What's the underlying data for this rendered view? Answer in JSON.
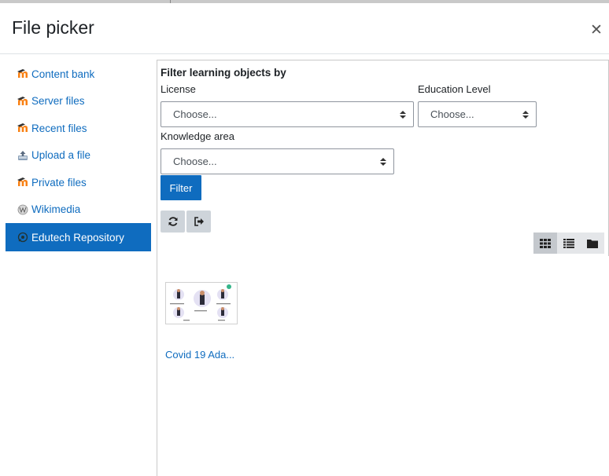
{
  "header": {
    "title": "File picker",
    "close_icon": "close-icon"
  },
  "sidebar": {
    "items": [
      {
        "label": "Content bank",
        "icon": "moodle-icon"
      },
      {
        "label": "Server files",
        "icon": "moodle-icon"
      },
      {
        "label": "Recent files",
        "icon": "moodle-icon"
      },
      {
        "label": "Upload a file",
        "icon": "upload-icon"
      },
      {
        "label": "Private files",
        "icon": "moodle-icon"
      },
      {
        "label": "Wikimedia",
        "icon": "wikimedia-icon"
      },
      {
        "label": "Edutech Repository",
        "icon": "repository-icon",
        "active": true
      }
    ]
  },
  "filters": {
    "title": "Filter learning objects by",
    "license_label": "License",
    "license_value": "Choose...",
    "education_label": "Education Level",
    "education_value": "Choose...",
    "knowledge_label": "Knowledge area",
    "knowledge_value": "Choose...",
    "filter_button": "Filter"
  },
  "toolbar": {
    "refresh_icon": "refresh-icon",
    "logout_icon": "logout-icon"
  },
  "view_modes": [
    {
      "icon": "grid-icon",
      "active": true
    },
    {
      "icon": "list-icon",
      "active": false
    },
    {
      "icon": "folder-icon",
      "active": false
    }
  ],
  "files": [
    {
      "name": "Covid 19 Ada..."
    }
  ],
  "colors": {
    "accent": "#0f6cbf",
    "active_view": "#c4c8cd",
    "toolbar_button": "#ced4da"
  }
}
